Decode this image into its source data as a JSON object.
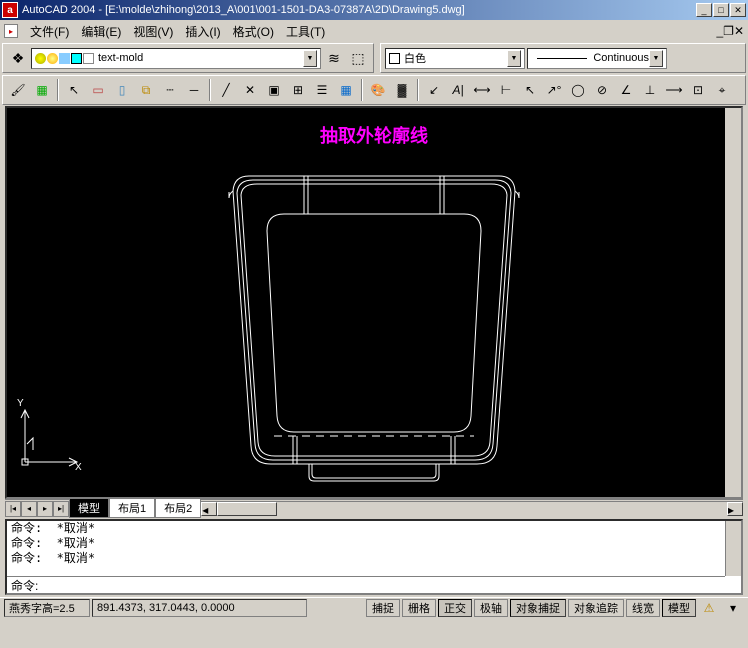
{
  "title": "AutoCAD 2004 - [E:\\molde\\zhihong\\2013_A\\001\\001-1501-DA3-07387A\\2D\\Drawing5.dwg]",
  "app_icon_letter": "a",
  "menus": {
    "file": "文件(F)",
    "edit": "编辑(E)",
    "view": "视图(V)",
    "insert": "插入(I)",
    "format": "格式(O)",
    "tools": "工具(T)"
  },
  "layer": {
    "current": "text-mold",
    "icons": [
      "bulb-on",
      "sun",
      "lock-open",
      "layer-color",
      "print"
    ]
  },
  "color": {
    "label": "白色",
    "bylayer_prefix": "□"
  },
  "linetype": {
    "label": "Continuous"
  },
  "tabs": {
    "model": "模型",
    "layout1": "布局1",
    "layout2": "布局2"
  },
  "annotation": "抽取外轮廓线",
  "ucs": {
    "y": "Y",
    "x": "X"
  },
  "cmd": {
    "l1": "命令:  *取消*",
    "l2": "命令:  *取消*",
    "l3": "命令:  *取消*",
    "prompt": "命令:"
  },
  "status": {
    "left": "燕秀字高=2.5",
    "coord": "891.4373, 317.0443, 0.0000",
    "snap": "捕捉",
    "grid": "栅格",
    "ortho": "正交",
    "polar": "极轴",
    "osnap": "对象捕捉",
    "otrack": "对象追踪",
    "lwt": "线宽",
    "model": "模型"
  }
}
